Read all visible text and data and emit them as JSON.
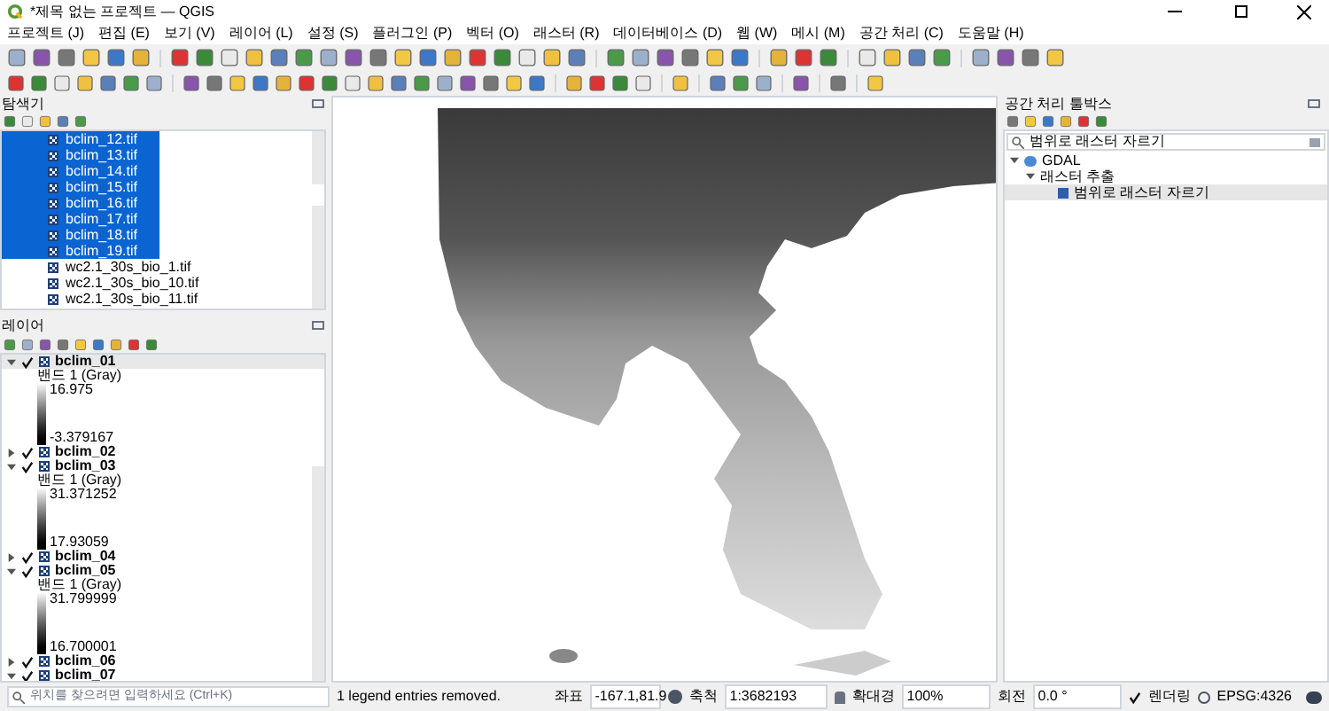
{
  "window": {
    "title": "*제목 없는 프로젝트 — QGIS"
  },
  "menu": [
    "프로젝트 (J)",
    "편집 (E)",
    "보기 (V)",
    "레이어 (L)",
    "설정 (S)",
    "플러그인 (P)",
    "벡터 (O)",
    "래스터 (R)",
    "데이터베이스 (D)",
    "웹 (W)",
    "메시 (M)",
    "공간 처리 (C)",
    "도움말 (H)"
  ],
  "browser": {
    "title": "탐색기",
    "items": [
      {
        "label": "bclim_12.tif",
        "selected": true
      },
      {
        "label": "bclim_13.tif",
        "selected": true
      },
      {
        "label": "bclim_14.tif",
        "selected": true
      },
      {
        "label": "bclim_15.tif",
        "selected": true
      },
      {
        "label": "bclim_16.tif",
        "selected": true
      },
      {
        "label": "bclim_17.tif",
        "selected": true
      },
      {
        "label": "bclim_18.tif",
        "selected": true
      },
      {
        "label": "bclim_19.tif",
        "selected": true
      },
      {
        "label": "wc2.1_30s_bio_1.tif",
        "selected": false
      },
      {
        "label": "wc2.1_30s_bio_10.tif",
        "selected": false
      },
      {
        "label": "wc2.1_30s_bio_11.tif",
        "selected": false
      }
    ]
  },
  "layers": {
    "title": "레이어",
    "items": [
      {
        "name": "bclim_01",
        "checked": true,
        "expanded": true,
        "selected": true,
        "band": "밴드 1 (Gray)",
        "max": "16.975",
        "min": "-3.379167"
      },
      {
        "name": "bclim_02",
        "checked": true,
        "expanded": false,
        "selected": false
      },
      {
        "name": "bclim_03",
        "checked": true,
        "expanded": true,
        "selected": false,
        "band": "밴드 1 (Gray)",
        "max": "31.371252",
        "min": "17.93059"
      },
      {
        "name": "bclim_04",
        "checked": true,
        "expanded": false,
        "selected": false
      },
      {
        "name": "bclim_05",
        "checked": true,
        "expanded": true,
        "selected": false,
        "band": "밴드 1 (Gray)",
        "max": "31.799999",
        "min": "16.700001"
      },
      {
        "name": "bclim_06",
        "checked": true,
        "expanded": false,
        "selected": false
      },
      {
        "name": "bclim_07",
        "checked": true,
        "expanded": true,
        "selected": false
      }
    ]
  },
  "toolbox": {
    "title": "공간 처리 툴박스",
    "search": "범위로 래스터 자르기",
    "tree": [
      {
        "label": "GDAL",
        "expanded": true,
        "children": [
          {
            "label": "래스터 추출",
            "expanded": true,
            "children": [
              {
                "label": "범위로 래스터 자르기",
                "selected": true
              }
            ]
          }
        ]
      }
    ]
  },
  "status_bar": {
    "search_placeholder": "위치를 찾으려면 입력하세요 (Ctrl+K)",
    "message": "1 legend entries removed.",
    "coordinate_label": "좌표",
    "coordinate": "-167.1,81.9",
    "scale_label": "축척",
    "scale": "1:3682193",
    "magnifier_label": "확대경",
    "magnifier": "100%",
    "rotation_label": "회전",
    "rotation": "0.0 °",
    "render_label": "렌더링",
    "render_checked": true,
    "crs": "EPSG:4326"
  }
}
